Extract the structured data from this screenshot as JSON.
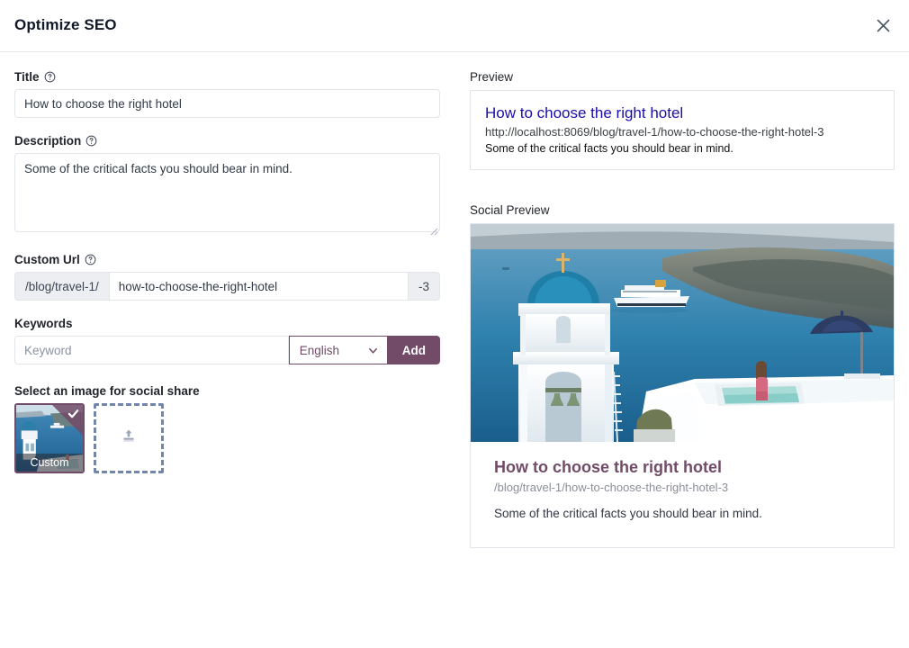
{
  "dialog": {
    "title": "Optimize SEO",
    "close_icon": "close-icon"
  },
  "form": {
    "title": {
      "label": "Title",
      "help_icon": "help-circle-icon",
      "value": "How to choose the right hotel",
      "placeholder": ""
    },
    "description": {
      "label": "Description",
      "help_icon": "help-circle-icon",
      "value": "Some of the critical facts you should bear in mind.",
      "placeholder": ""
    },
    "custom_url": {
      "label": "Custom Url",
      "help_icon": "help-circle-icon",
      "prefix": "/blog/travel-1/",
      "value": "how-to-choose-the-right-hotel",
      "placeholder": "",
      "suffix": "-3"
    },
    "keywords": {
      "label": "Keywords",
      "placeholder": "Keyword",
      "value": "",
      "language_selected": "English",
      "language_options": [
        "English"
      ],
      "chevron_icon": "chevron-down-icon",
      "add_label": "Add"
    },
    "social_image": {
      "label": "Select an image for social share",
      "thumb_caption": "Custom",
      "thumb_check_icon": "check-icon",
      "upload_icon": "upload-icon"
    }
  },
  "preview": {
    "label": "Preview",
    "title": "How to choose the right hotel",
    "url": "http://localhost:8069/blog/travel-1/how-to-choose-the-right-hotel-3",
    "description": "Some of the critical facts you should bear in mind."
  },
  "social_preview": {
    "label": "Social Preview",
    "image_alt": "santorini-blue-dome-church-photo",
    "title": "How to choose the right hotel",
    "url": "/blog/travel-1/how-to-choose-the-right-hotel-3",
    "description": "Some of the critical facts you should bear in mind."
  },
  "colors": {
    "accent": "#714b67",
    "link": "#1a0dab",
    "border": "#e2e5ea",
    "muted_bg": "#eceef1",
    "dashed_border": "#7186a8"
  }
}
